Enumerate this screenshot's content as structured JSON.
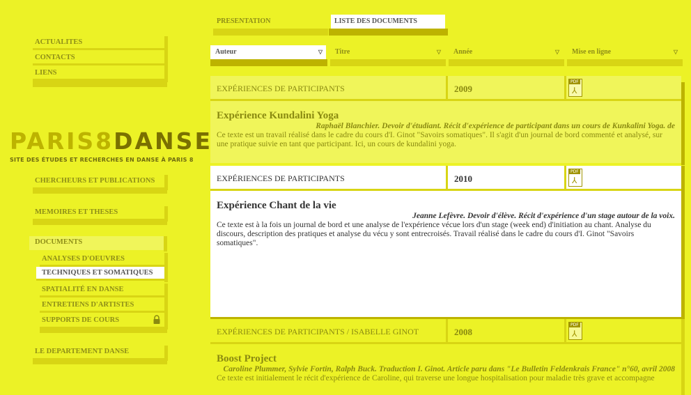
{
  "top_nav": [
    {
      "label": "ACTUALITES"
    },
    {
      "label": "CONTACTS"
    },
    {
      "label": "LIENS"
    }
  ],
  "logo": {
    "part1": "PARIS8",
    "part2": "DANSE",
    "tagline": "SITE DES ÉTUDES ET RECHERCHES EN DANSE À PARIS 8"
  },
  "sections": {
    "chercheurs": "CHERCHEURS ET PUBLICATIONS",
    "memoires": "MEMOIRES ET THESES",
    "documents": "DOCUMENTS",
    "departement": "LE DEPARTEMENT DANSE"
  },
  "documents_sub": [
    {
      "label": "ANALYSES D'OEUVRES"
    },
    {
      "label": "TECHNIQUES ET SOMATIQUES",
      "selected": true
    },
    {
      "label": "SPATIALITÉ EN DANSE"
    },
    {
      "label": "ENTRETIENS D'ARTISTES"
    },
    {
      "label": "SUPPORTS DE COURS",
      "icon": "lock-icon"
    }
  ],
  "tabs": [
    {
      "label": "PRESENTATION"
    },
    {
      "label": "LISTE DES DOCUMENTS",
      "active": true
    }
  ],
  "filters": [
    {
      "label": "Auteur",
      "active": true
    },
    {
      "label": "Titre"
    },
    {
      "label": "Année"
    },
    {
      "label": "Mise en ligne"
    }
  ],
  "filter_arrow": "▽",
  "colors": {
    "background": "#ecf226",
    "shadow": "#d8d514",
    "dark_shadow": "#bdb300",
    "highlight": "#f0f55a",
    "text": "#8a8a10"
  },
  "documents": [
    {
      "category": "EXPÉRIENCES DE PARTICIPANTS",
      "year": "2009",
      "file_icon": "pdf-icon",
      "title": "Expérience Kundalini Yoga",
      "author": "Raphaël Blanchier. Devoir d'étudiant. Récit d'expérience de participant dans un cours de Kunkalini Yoga. de",
      "summary": "Ce texte est un travail réalisé dans le cadre du cours d'I. Ginot \"Savoirs somatiques\". Il s'agit d'un journal de bord commenté et analysé, sur une pratique suivie en tant que participant. Ici, un cours de kundalini yoga."
    },
    {
      "category": "EXPÉRIENCES DE PARTICIPANTS",
      "year": "2010",
      "file_icon": "pdf-icon",
      "title": "Expérience Chant de la vie",
      "author": "Jeanne Lefèvre. Devoir d'élève. Récit d'expérience d'un stage autour de la voix.",
      "summary": "Ce texte est à la fois un journal de bord et une analyse de l'expérience vécue lors d'un stage (week end) d'initiation au chant. Analyse du discours, description des pratiques et analyse du vécu y sont entrecroisés. Travail réalisé dans le cadre du cours d'I. Ginot \"Savoirs somatiques\"."
    },
    {
      "category": "EXPÉRIENCES DE PARTICIPANTS / ISABELLE GINOT",
      "year": "2008",
      "file_icon": "pdf-icon",
      "title": "Boost Project",
      "author": "Caroline Plummer, Sylvie Fortin, Ralph Buck. Traduction I. Ginot. Article paru dans \"Le Bulletin Feldenkrais France\" n°60, avril 2008",
      "summary": "Ce texte est initialement le récit d'expérience de Caroline, qui traverse une longue hospitalisation pour maladie très grave et accompagne"
    }
  ]
}
